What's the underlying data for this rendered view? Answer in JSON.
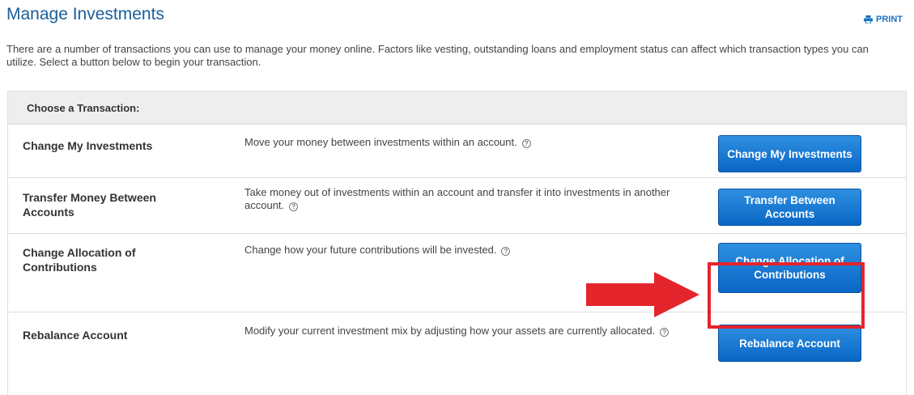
{
  "page": {
    "title": "Manage Investments",
    "print_label": "PRINT",
    "intro": "There are a number of transactions you can use to manage your money online. Factors like vesting, outstanding loans and employment status can affect which transaction types you can utilize. Select a button below to begin your transaction."
  },
  "table": {
    "header": "Choose a Transaction:",
    "rows": [
      {
        "title": "Change My Investments",
        "description": "Move your money between investments within an account.",
        "button": "Change My Investments"
      },
      {
        "title": "Transfer Money Between Accounts",
        "description": "Take money out of investments within an account and transfer it into investments in another account.",
        "button": "Transfer Between Accounts"
      },
      {
        "title": "Change Allocation of Contributions",
        "description": "Change how your future contributions will be invested.",
        "button": "Change Allocation of Contributions"
      },
      {
        "title": "Rebalance Account",
        "description": "Modify your current investment mix by adjusting how your assets are currently allocated.",
        "button": "Rebalance Account"
      }
    ]
  },
  "icons": {
    "help": "question-circle-icon",
    "print": "printer-icon",
    "annotation": "red-arrow-icon"
  },
  "colors": {
    "title": "#1a5e9a",
    "button": "#0a67c6",
    "highlight": "#e4252c"
  }
}
